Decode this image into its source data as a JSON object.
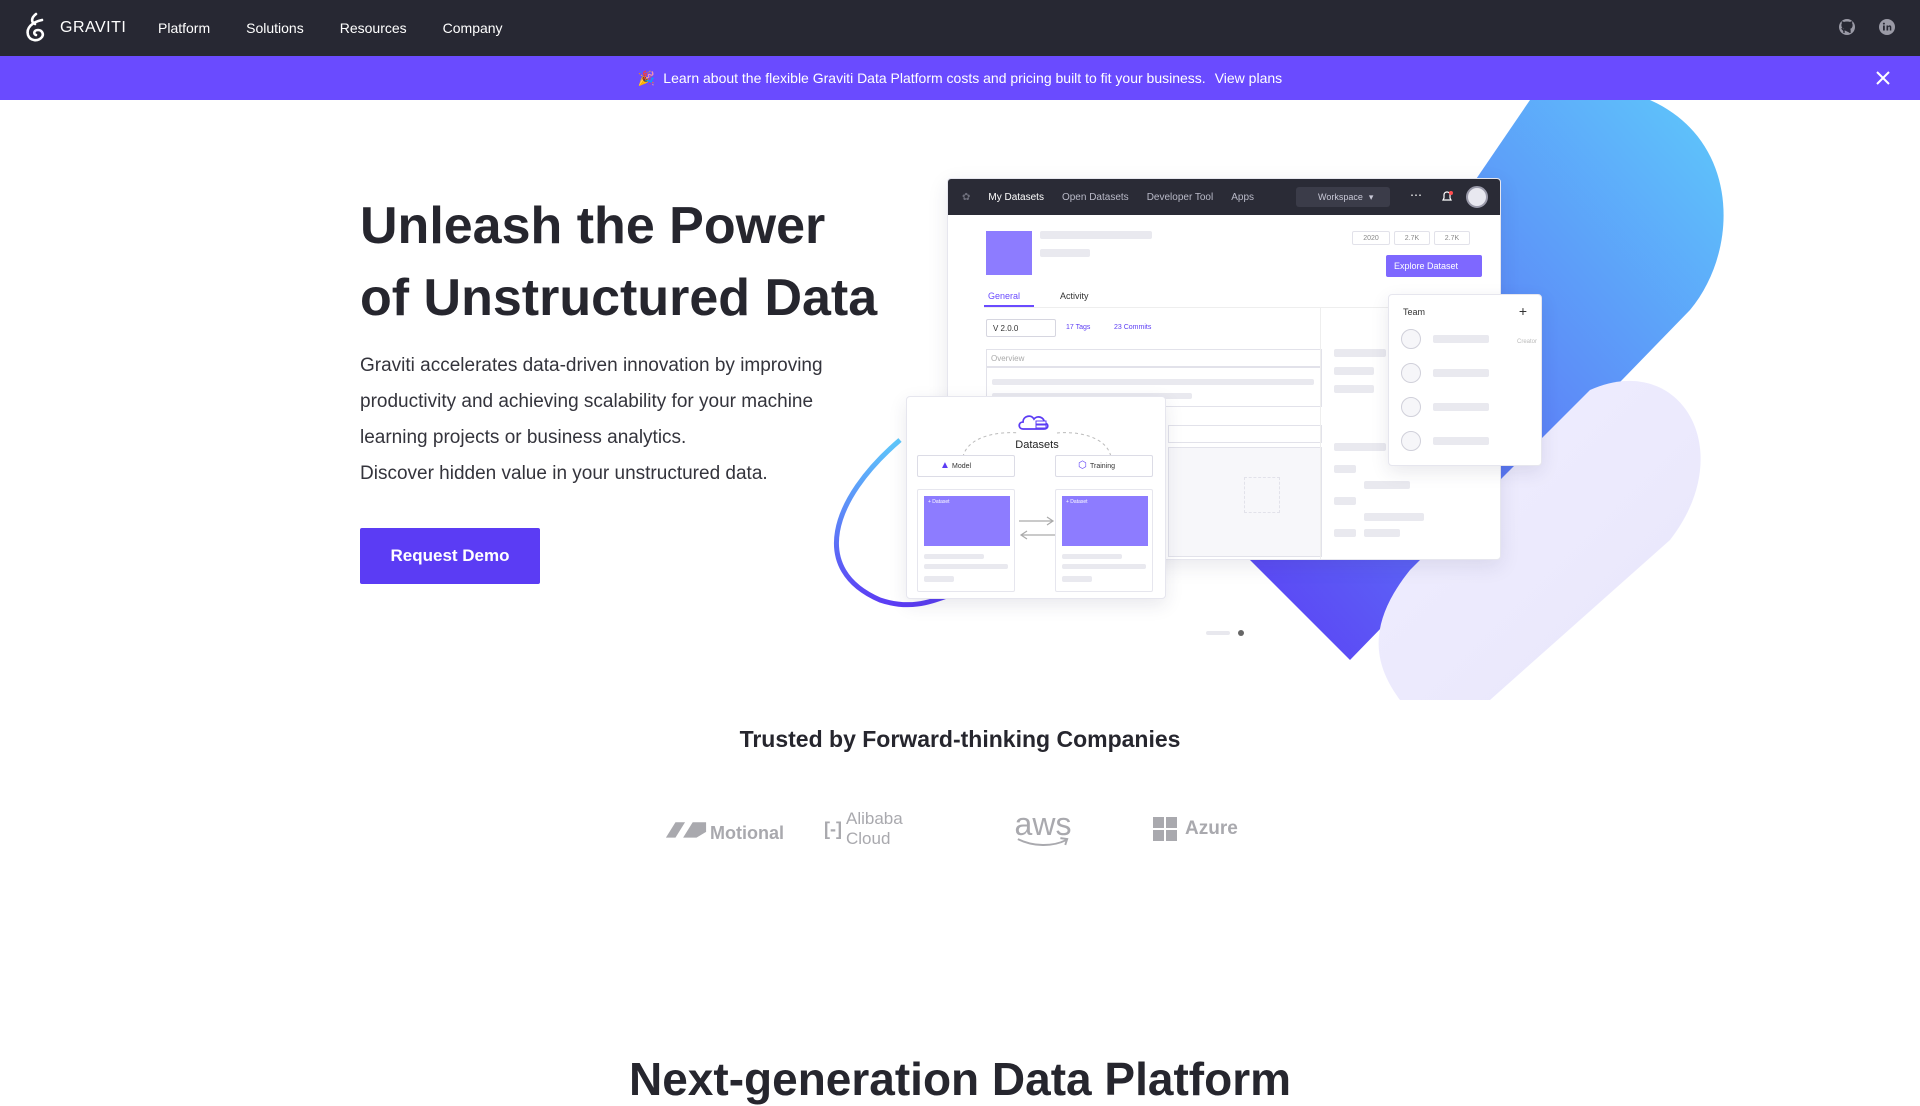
{
  "nav": {
    "brand": "GRAVITI",
    "links": [
      "Platform",
      "Solutions",
      "Resources",
      "Company"
    ],
    "icons": [
      "github-icon",
      "linkedin-icon"
    ]
  },
  "banner": {
    "emoji": "🎉",
    "text": "Learn about the flexible Graviti Data Platform costs and pricing built to fit your business.",
    "link": "View plans"
  },
  "hero": {
    "title_line1": "Unleash the Power",
    "title_line2": "of Unstructured Data",
    "desc_line1": "Graviti accelerates data-driven innovation by improving",
    "desc_line2": "productivity and achieving scalability for your machine",
    "desc_line3": "learning projects or business analytics.",
    "desc_line4": "Discover hidden value in your unstructured data.",
    "cta": "Request Demo"
  },
  "mock": {
    "tabs": [
      "My Datasets",
      "Open Datasets",
      "Developer Tool",
      "Apps"
    ],
    "workspace": "Workspace",
    "stats": [
      "2020",
      "2.7K",
      "2.7K"
    ],
    "explore": "Explore Dataset",
    "tab_general": "General",
    "tab_activity": "Activity",
    "version": "V 2.0.0",
    "tags": "17 Tags",
    "commits": "23 Commits",
    "overview": "Overview",
    "team_title": "Team",
    "team_plus": "+",
    "creator": "Creator",
    "datasets_label": "Datasets",
    "chip_model": "Model",
    "chip_training": "Training",
    "card_label": "+ Dataset"
  },
  "trusted": {
    "title": "Trusted by Forward-thinking Companies",
    "companies": [
      "Motional",
      "Alibaba Cloud",
      "aws",
      "Azure"
    ]
  },
  "next": {
    "title": "Next-generation Data Platform"
  },
  "colors": {
    "nav_bg": "#272833",
    "banner_bg": "#6a4bff",
    "cta_bg": "#5b3cf4"
  }
}
